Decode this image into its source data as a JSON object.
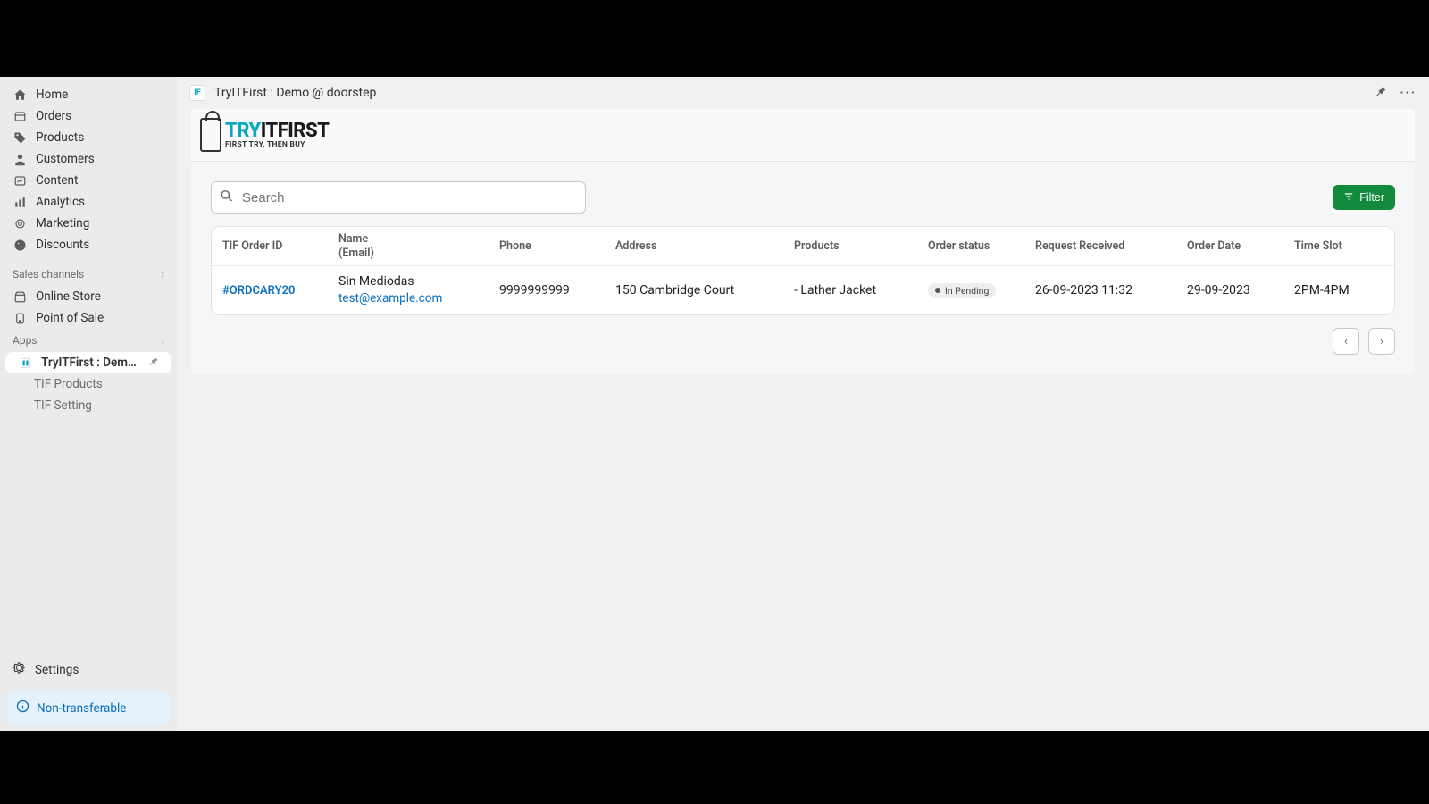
{
  "titlebar": {
    "title": "TryITFirst : Demo @ doorstep"
  },
  "sidebar": {
    "items": [
      {
        "label": "Home"
      },
      {
        "label": "Orders"
      },
      {
        "label": "Products"
      },
      {
        "label": "Customers"
      },
      {
        "label": "Content"
      },
      {
        "label": "Analytics"
      },
      {
        "label": "Marketing"
      },
      {
        "label": "Discounts"
      }
    ],
    "sales_header": "Sales channels",
    "sales": [
      {
        "label": "Online Store"
      },
      {
        "label": "Point of Sale"
      }
    ],
    "apps_header": "Apps",
    "active_app": "TryITFirst : Demo @ d...",
    "app_subs": [
      {
        "label": "TIF Products"
      },
      {
        "label": "TIF Setting"
      }
    ],
    "settings": "Settings",
    "nontransferable": "Non-transferable"
  },
  "brand": {
    "try": "TRY",
    "it": "IT",
    "first": "FIRST",
    "tag": "FIRST TRY, THEN BUY"
  },
  "toolbar": {
    "search_placeholder": "Search",
    "filter_label": "Filter"
  },
  "table": {
    "headers": {
      "order_id": "TIF Order ID",
      "name": "Name",
      "email": "(Email)",
      "phone": "Phone",
      "address": "Address",
      "products": "Products",
      "status": "Order status",
      "request": "Request Received",
      "order_date": "Order Date",
      "slot": "Time Slot"
    },
    "rows": [
      {
        "order_id": "#ORDCARY20",
        "name": "Sin Mediodas",
        "email": "test@example.com",
        "phone": "9999999999",
        "address": "150 Cambridge Court",
        "products": "- Lather Jacket",
        "status": "In Pending",
        "request": "26-09-2023 11:32",
        "order_date": "29-09-2023",
        "slot": "2PM-4PM"
      }
    ]
  }
}
